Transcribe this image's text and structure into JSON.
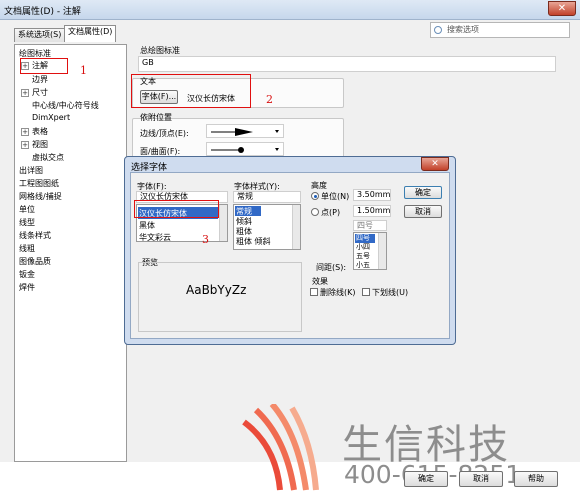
{
  "window": {
    "title": "文档属性(D) - 注解",
    "close": "✕"
  },
  "tabs": [
    {
      "label": "系统选项(S)"
    },
    {
      "label": "文档属性(D)"
    }
  ],
  "search": {
    "placeholder": "搜索选项"
  },
  "tree": {
    "items": [
      {
        "label": "绘图标准"
      },
      {
        "label": "注解"
      },
      {
        "label": "边界"
      },
      {
        "label": "尺寸"
      },
      {
        "label": "中心线/中心符号线"
      },
      {
        "label": "DimXpert"
      },
      {
        "label": "表格"
      },
      {
        "label": "视图"
      },
      {
        "label": "虚拟交点"
      },
      {
        "label": "出详图"
      },
      {
        "label": "工程图图纸"
      },
      {
        "label": "网格线/捕捉"
      },
      {
        "label": "单位"
      },
      {
        "label": "线型"
      },
      {
        "label": "线条样式"
      },
      {
        "label": "线粗"
      },
      {
        "label": "图像品质"
      },
      {
        "label": "钣金"
      },
      {
        "label": "焊件"
      }
    ]
  },
  "panel": {
    "standard_label": "总绘图标准",
    "standard_value": "GB",
    "text_label": "文本",
    "font_button": "字体(F)...",
    "font_value": "汉仪长仿宋体",
    "leader_label": "依附位置",
    "edge_label": "边线/顶点(E):",
    "face_label": "面/曲面(F):"
  },
  "annotations": {
    "n1": "1",
    "n2": "2",
    "n3": "3"
  },
  "dialog": {
    "title": "选择字体",
    "close": "✕",
    "font_label": "字体(F):",
    "font_current": "汉仪长仿宋体",
    "font_list": [
      "汉仪长仿宋体",
      "黑体",
      "华文彩云"
    ],
    "style_label": "字体样式(Y):",
    "style_current": "常规",
    "style_list": [
      "常规",
      "倾斜",
      "粗体",
      "粗体 倾斜"
    ],
    "height_label": "高度",
    "unit_radio": "单位(N)",
    "unit_value": "3.50mm",
    "point_radio": "点(P)",
    "spacing_value": "1.50mm",
    "point_current": "四号",
    "point_list": [
      "四号",
      "小四",
      "五号",
      "小五"
    ],
    "spacing_label": "间距(S):",
    "preview_label": "预览",
    "preview_text": "AaBbYyZz",
    "effects_label": "效果",
    "strike_label": "删除线(K)",
    "underline_label": "下划线(U)",
    "ok": "确定",
    "cancel": "取消"
  },
  "watermark": {
    "brand": "生信科技",
    "phone": "400-615-8251"
  },
  "bottom": {
    "ok": "确定",
    "cancel": "取消",
    "help": "帮助"
  },
  "colors": {
    "highlight": "#3169c6",
    "red": "#e01010",
    "titlebar": "#c6d7ec"
  }
}
